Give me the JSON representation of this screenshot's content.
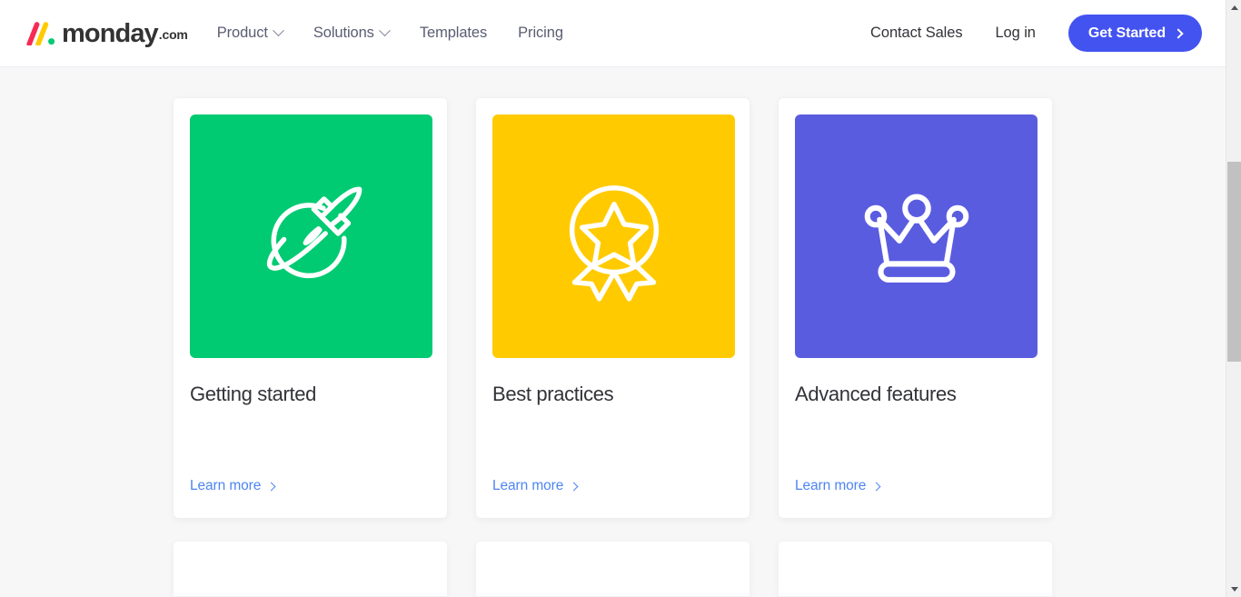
{
  "header": {
    "brand": {
      "word": "monday",
      "tld": ".com",
      "logo_colors": {
        "slash1": "#f62b54",
        "slash2": "#ffcb00",
        "dot": "#00ca72"
      }
    },
    "nav": [
      {
        "label": "Product",
        "has_dropdown": true
      },
      {
        "label": "Solutions",
        "has_dropdown": true
      },
      {
        "label": "Templates",
        "has_dropdown": false
      },
      {
        "label": "Pricing",
        "has_dropdown": false
      }
    ],
    "contact_sales": "Contact Sales",
    "log_in": "Log in",
    "cta": {
      "label": "Get Started",
      "color": "#4353f0"
    }
  },
  "main": {
    "cards": [
      {
        "title": "Getting started",
        "link": "Learn more",
        "tile_color": "#00ca72",
        "icon": "rocket-planet-icon"
      },
      {
        "title": "Best practices",
        "link": "Learn more",
        "tile_color": "#ffcb00",
        "icon": "award-ribbon-icon"
      },
      {
        "title": "Advanced features",
        "link": "Learn more",
        "tile_color": "#5a5ce0",
        "icon": "crown-icon"
      }
    ]
  },
  "scrollbar": {
    "up_label": "scroll up",
    "down_label": "scroll down"
  }
}
